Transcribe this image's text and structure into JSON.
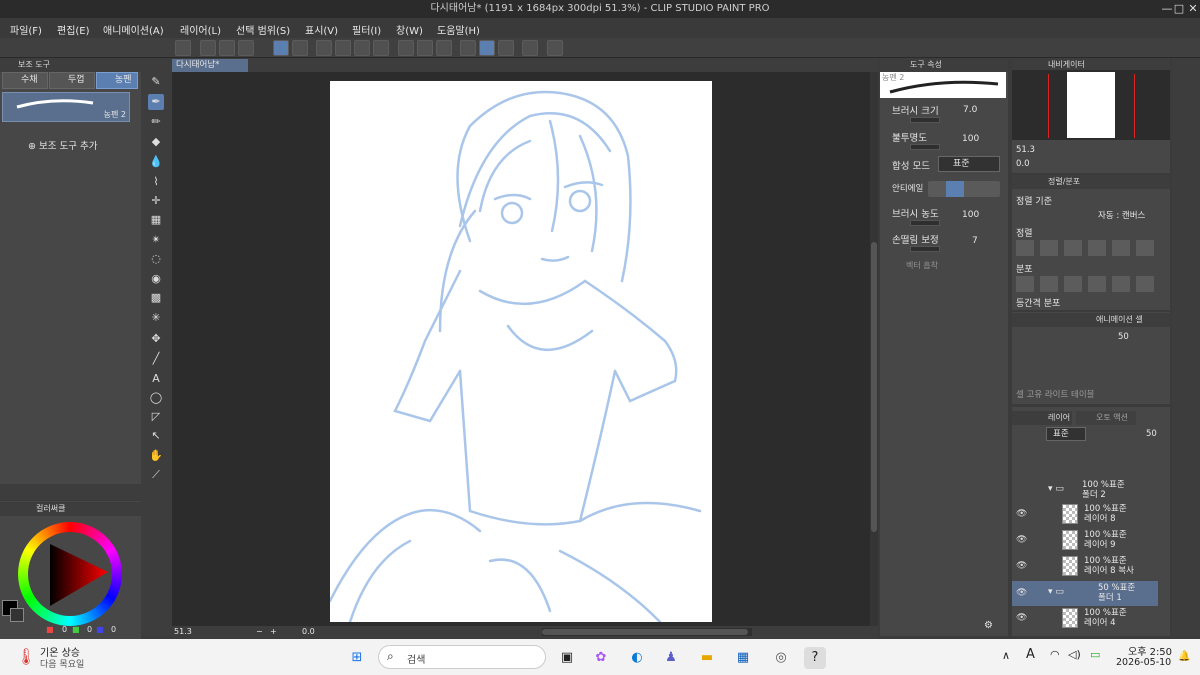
{
  "window": {
    "title": "다시태어남* (1191 x 1684px 300dpi 51.3%) - CLIP STUDIO PAINT PRO",
    "minimize": "□",
    "close": "✕"
  },
  "menu": [
    "파일(F)",
    "편집(E)",
    "애니메이션(A)",
    "레이어(L)",
    "선택 범위(S)",
    "표시(V)",
    "필터(I)",
    "창(W)",
    "도움말(H)"
  ],
  "sub_tool": {
    "header": "보조 도구",
    "tabs": [
      "수채",
      "두껍",
      "농펜"
    ],
    "selected_tool": "농펜 2",
    "add_label": "보조 도구 추가"
  },
  "color": {
    "header": "컬러써클",
    "values": [
      "0",
      "0",
      "0"
    ]
  },
  "canvas": {
    "tab": "다시태어남*",
    "zoom": "51.3",
    "angle": "0.0"
  },
  "tool_property": {
    "header": "도구 속성",
    "tool_name": "농펜 2",
    "rows": [
      {
        "label": "브러시 크기",
        "value": "7.0"
      },
      {
        "label": "불투명도",
        "value": "100"
      },
      {
        "label": "합성 모드",
        "value": "표준"
      },
      {
        "label": "안티에일",
        "value": ""
      },
      {
        "label": "브러시 농도",
        "value": "100"
      },
      {
        "label": "손떨림 보정",
        "value": "7"
      },
      {
        "label": "벡터 흡착",
        "value": ""
      }
    ]
  },
  "navigator": {
    "header": "내비게이터",
    "zoom": "51.3",
    "angle": "0.0"
  },
  "align": {
    "header": "정렬/분포",
    "basis_label": "정렬 기준",
    "basis_value": "자동 : 캔버스",
    "align_label": "정렬",
    "dist_label": "분포",
    "spacing_label": "등간격 분포"
  },
  "animation_cel": {
    "header": "애니메이션 셀",
    "value": "50"
  },
  "layer_property": {
    "placeholder": "셀 고유 라이트 테이블"
  },
  "layers": {
    "header": "레이어",
    "tab2": "오토 액션",
    "blend": "표준",
    "opacity": "50",
    "items": [
      {
        "line1": "100 %표준",
        "line2": "폴더 2"
      },
      {
        "line1": "100 %표준",
        "line2": "레이어 8"
      },
      {
        "line1": "100 %표준",
        "line2": "레이어 9"
      },
      {
        "line1": "100 %표준",
        "line2": "레이어 8 복사"
      },
      {
        "line1": "50 %표준",
        "line2": "폴더 1"
      },
      {
        "line1": "100 %표준",
        "line2": "레이어 4"
      }
    ]
  },
  "taskbar": {
    "weather_title": "기온 상승",
    "weather_sub": "다음 목요일",
    "search_placeholder": "검색",
    "time": "오후 2:50",
    "date": "2026-05-10",
    "ime": "A"
  },
  "colors": {
    "accent": "#5a7fb0",
    "sketch": "#a9c6ea"
  }
}
